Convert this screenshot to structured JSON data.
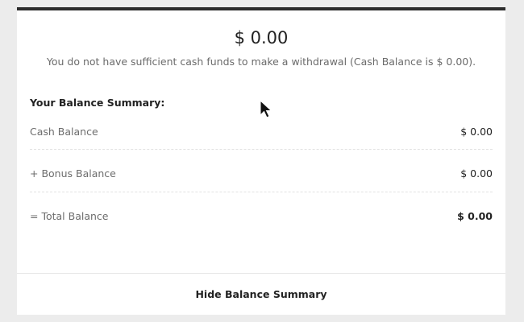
{
  "withdrawal": {
    "amount": "$ 0.00",
    "notice": "You do not have sufficient cash funds to make a withdrawal (Cash Balance is $ 0.00)."
  },
  "summary": {
    "title": "Your Balance Summary:",
    "rows": [
      {
        "label": "Cash Balance",
        "value": "$ 0.00"
      },
      {
        "label": "+ Bonus Balance",
        "value": "$ 0.00"
      },
      {
        "label": "= Total Balance",
        "value": "$ 0.00"
      }
    ]
  },
  "footer": {
    "hide_label": "Hide Balance Summary"
  },
  "colors": {
    "top_border": "#2c2c2c",
    "background": "#ececec",
    "card": "#ffffff"
  },
  "icons": {
    "cursor": "mouse-pointer-icon"
  }
}
